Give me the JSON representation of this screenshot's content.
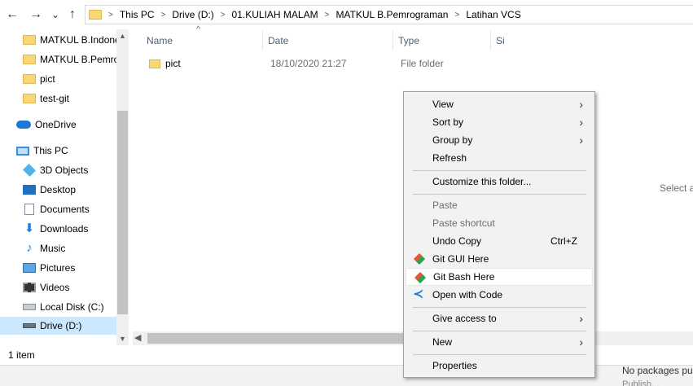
{
  "breadcrumb": [
    "This PC",
    "Drive (D:)",
    "01.KULIAH MALAM",
    "MATKUL B.Pemrograman",
    "Latihan VCS"
  ],
  "nav": {
    "back_glyph": "←",
    "forward_glyph": "→",
    "recent_glyph": "⌄",
    "up_glyph": "↑"
  },
  "sidebar": {
    "items": [
      {
        "label": "MATKUL B.Indonesia",
        "icon": "folder-icon"
      },
      {
        "label": "MATKUL B.Pemrograman",
        "icon": "folder-icon"
      },
      {
        "label": "pict",
        "icon": "folder-icon"
      },
      {
        "label": "test-git",
        "icon": "folder-icon"
      },
      {
        "label": "OneDrive",
        "icon": "onedrive-icon"
      },
      {
        "label": "This PC",
        "icon": "computer-icon"
      },
      {
        "label": "3D Objects",
        "icon": "cube-icon"
      },
      {
        "label": "Desktop",
        "icon": "desktop-icon"
      },
      {
        "label": "Documents",
        "icon": "documents-icon"
      },
      {
        "label": "Downloads",
        "icon": "download-icon"
      },
      {
        "label": "Music",
        "icon": "music-icon"
      },
      {
        "label": "Pictures",
        "icon": "pictures-icon"
      },
      {
        "label": "Videos",
        "icon": "videos-icon"
      },
      {
        "label": "Local Disk (C:)",
        "icon": "disk-icon"
      },
      {
        "label": "Drive (D:)",
        "icon": "drive-icon"
      }
    ]
  },
  "columns": {
    "name": "Name",
    "date": "Date",
    "type": "Type",
    "size": "Si"
  },
  "files": [
    {
      "name": "pict",
      "date": "18/10/2020 21:27",
      "type": "File folder"
    }
  ],
  "preview_text": "Select a",
  "status": {
    "item_count": "1 item"
  },
  "bottom": {
    "text": "No packages pul",
    "text2": "Publish..."
  },
  "context_menu": {
    "items": [
      {
        "label": "View",
        "submenu": true
      },
      {
        "label": "Sort by",
        "submenu": true
      },
      {
        "label": "Group by",
        "submenu": true
      },
      {
        "label": "Refresh"
      },
      {
        "label": "Customize this folder..."
      },
      {
        "label": "Paste",
        "disabled": true
      },
      {
        "label": "Paste shortcut",
        "disabled": true
      },
      {
        "label": "Undo Copy",
        "shortcut": "Ctrl+Z"
      },
      {
        "label": "Git GUI Here",
        "icon": "git-icon"
      },
      {
        "label": "Git Bash Here",
        "icon": "git-icon"
      },
      {
        "label": "Open with Code",
        "icon": "vscode-icon"
      },
      {
        "label": "Give access to",
        "submenu": true
      },
      {
        "label": "New",
        "submenu": true
      },
      {
        "label": "Properties"
      }
    ],
    "submenu_glyph": "›"
  }
}
